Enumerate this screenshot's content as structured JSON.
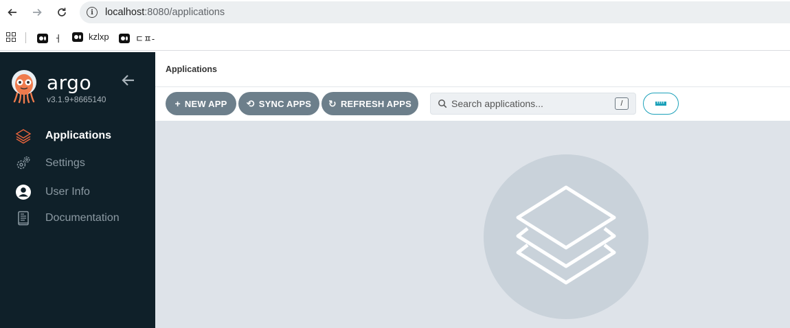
{
  "browser": {
    "url_host": "localhost",
    "url_path": ":8080/applications",
    "bookmarks": [
      {
        "label": "ㅓ"
      },
      {
        "label": "kzlxp"
      },
      {
        "label": "ㄷㅍ-"
      }
    ]
  },
  "sidebar": {
    "brand": "argo",
    "version": "v3.1.9+8665140",
    "items": [
      {
        "label": "Applications",
        "icon": "layers-icon",
        "active": true
      },
      {
        "label": "Settings",
        "icon": "gears-icon",
        "active": false
      },
      {
        "label": "User Info",
        "icon": "user-circle-icon",
        "active": false
      },
      {
        "label": "Documentation",
        "icon": "book-icon",
        "active": false
      }
    ]
  },
  "header": {
    "title": "Applications"
  },
  "toolbar": {
    "new_app": "NEW APP",
    "sync_apps": "SYNC APPS",
    "refresh_apps": "REFRESH APPS",
    "search_placeholder": "Search applications...",
    "search_shortcut": "/"
  },
  "colors": {
    "sidebar_bg": "#0f2029",
    "button_bg": "#6d7f8b",
    "accent": "#1aa0b9",
    "content_bg": "#dee3e9",
    "active_icon": "#e8643c"
  }
}
